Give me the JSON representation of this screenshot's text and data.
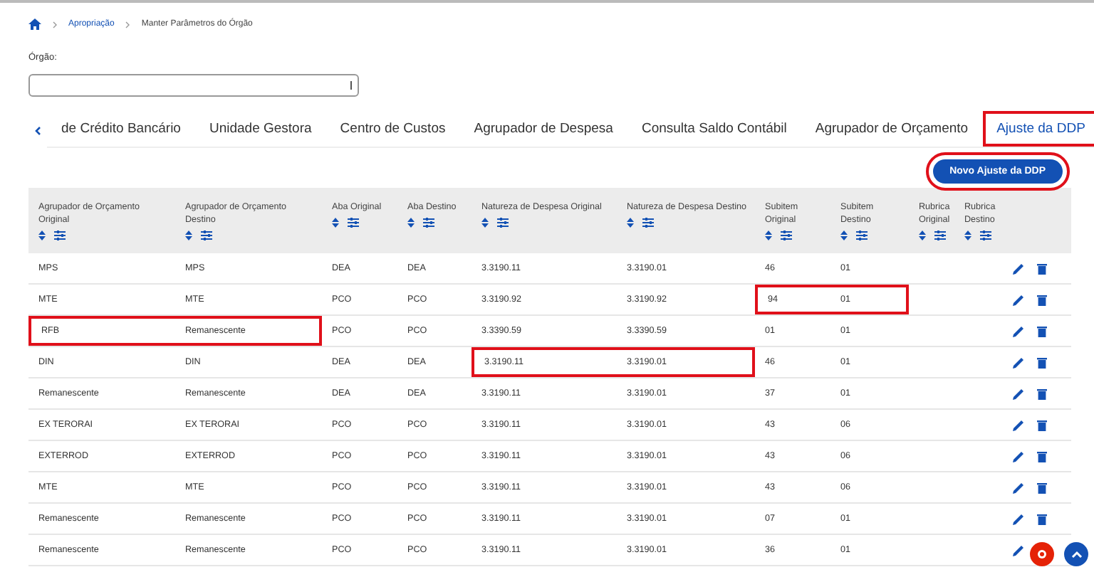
{
  "breadcrumb": {
    "links": [
      "Apropriação"
    ],
    "current": "Manter Parâmetros do Órgão"
  },
  "orgao": {
    "label": "Órgão:"
  },
  "tabs": [
    {
      "label": "de Crédito Bancário",
      "selected": false,
      "boxed": false
    },
    {
      "label": "Unidade Gestora",
      "selected": false,
      "boxed": false
    },
    {
      "label": "Centro de Custos",
      "selected": false,
      "boxed": false
    },
    {
      "label": "Agrupador de Despesa",
      "selected": false,
      "boxed": false
    },
    {
      "label": "Consulta Saldo Contábil",
      "selected": false,
      "boxed": false
    },
    {
      "label": "Agrupador de Orçamento",
      "selected": false,
      "boxed": false
    },
    {
      "label": "Ajuste da DDP",
      "selected": true,
      "boxed": true
    }
  ],
  "new_button": {
    "label": "Novo Ajuste da DDP",
    "boxed": true
  },
  "table": {
    "columns": [
      "Agrupador de Orçamento Original",
      "Agrupador de Orçamento Destino",
      "Aba Original",
      "Aba Destino",
      "Natureza de Despesa Original",
      "Natureza de Despesa Destino",
      "Subitem Original",
      "Subitem Destino",
      "Rubrica Original",
      "Rubrica Destino"
    ],
    "rows": [
      {
        "cells": [
          {
            "text": "MPS",
            "boxed": false
          },
          {
            "text": "MPS",
            "boxed": false
          },
          {
            "text": "DEA",
            "boxed": false
          },
          {
            "text": "DEA",
            "boxed": false
          },
          {
            "text": "3.3190.11",
            "boxed": false
          },
          {
            "text": "3.3190.01",
            "boxed": false
          },
          {
            "text": "46",
            "boxed": false
          },
          {
            "text": "01",
            "boxed": false
          }
        ]
      },
      {
        "cells": [
          {
            "text": "MTE",
            "boxed": false
          },
          {
            "text": "MTE",
            "boxed": false
          },
          {
            "text": "PCO",
            "boxed": false
          },
          {
            "text": "PCO",
            "boxed": false
          },
          {
            "text": "3.3190.92",
            "boxed": false
          },
          {
            "text": "3.3190.92",
            "boxed": false
          },
          {
            "text": "94",
            "boxed": true
          },
          {
            "text": "01",
            "boxed": true
          }
        ]
      },
      {
        "cells": [
          {
            "text": "RFB",
            "boxed": true
          },
          {
            "text": "Remanescente",
            "boxed": true
          },
          {
            "text": "PCO",
            "boxed": false
          },
          {
            "text": "PCO",
            "boxed": false
          },
          {
            "text": "3.3390.59",
            "boxed": false
          },
          {
            "text": "3.3390.59",
            "boxed": false
          },
          {
            "text": "01",
            "boxed": false
          },
          {
            "text": "01",
            "boxed": false
          }
        ]
      },
      {
        "cells": [
          {
            "text": "DIN",
            "boxed": false
          },
          {
            "text": "DIN",
            "boxed": false
          },
          {
            "text": "DEA",
            "boxed": false
          },
          {
            "text": "DEA",
            "boxed": false
          },
          {
            "text": "3.3190.11",
            "boxed": true
          },
          {
            "text": "3.3190.01",
            "boxed": true
          },
          {
            "text": "46",
            "boxed": false
          },
          {
            "text": "01",
            "boxed": false
          }
        ]
      },
      {
        "cells": [
          {
            "text": "Remanescente",
            "boxed": false
          },
          {
            "text": "Remanescente",
            "boxed": false
          },
          {
            "text": "DEA",
            "boxed": false
          },
          {
            "text": "DEA",
            "boxed": false
          },
          {
            "text": "3.3190.11",
            "boxed": false
          },
          {
            "text": "3.3190.01",
            "boxed": false
          },
          {
            "text": "37",
            "boxed": false
          },
          {
            "text": "01",
            "boxed": false
          }
        ]
      },
      {
        "cells": [
          {
            "text": "EX TERORAI",
            "boxed": false
          },
          {
            "text": "EX TERORAI",
            "boxed": false
          },
          {
            "text": "PCO",
            "boxed": false
          },
          {
            "text": "PCO",
            "boxed": false
          },
          {
            "text": "3.3190.11",
            "boxed": false
          },
          {
            "text": "3.3190.01",
            "boxed": false
          },
          {
            "text": "43",
            "boxed": false
          },
          {
            "text": "06",
            "boxed": false
          }
        ]
      },
      {
        "cells": [
          {
            "text": "EXTERROD",
            "boxed": false
          },
          {
            "text": "EXTERROD",
            "boxed": false
          },
          {
            "text": "PCO",
            "boxed": false
          },
          {
            "text": "PCO",
            "boxed": false
          },
          {
            "text": "3.3190.11",
            "boxed": false
          },
          {
            "text": "3.3190.01",
            "boxed": false
          },
          {
            "text": "43",
            "boxed": false
          },
          {
            "text": "06",
            "boxed": false
          }
        ]
      },
      {
        "cells": [
          {
            "text": "MTE",
            "boxed": false
          },
          {
            "text": "MTE",
            "boxed": false
          },
          {
            "text": "PCO",
            "boxed": false
          },
          {
            "text": "PCO",
            "boxed": false
          },
          {
            "text": "3.3190.11",
            "boxed": false
          },
          {
            "text": "3.3190.01",
            "boxed": false
          },
          {
            "text": "43",
            "boxed": false
          },
          {
            "text": "06",
            "boxed": false
          }
        ]
      },
      {
        "cells": [
          {
            "text": "Remanescente",
            "boxed": false
          },
          {
            "text": "Remanescente",
            "boxed": false
          },
          {
            "text": "PCO",
            "boxed": false
          },
          {
            "text": "PCO",
            "boxed": false
          },
          {
            "text": "3.3190.11",
            "boxed": false
          },
          {
            "text": "3.3190.01",
            "boxed": false
          },
          {
            "text": "07",
            "boxed": false
          },
          {
            "text": "01",
            "boxed": false
          }
        ]
      },
      {
        "cells": [
          {
            "text": "Remanescente",
            "boxed": false
          },
          {
            "text": "Remanescente",
            "boxed": false
          },
          {
            "text": "PCO",
            "boxed": false
          },
          {
            "text": "PCO",
            "boxed": false
          },
          {
            "text": "3.3190.11",
            "boxed": false
          },
          {
            "text": "3.3190.01",
            "boxed": false
          },
          {
            "text": "36",
            "boxed": false
          },
          {
            "text": "01",
            "boxed": false
          }
        ]
      }
    ]
  }
}
